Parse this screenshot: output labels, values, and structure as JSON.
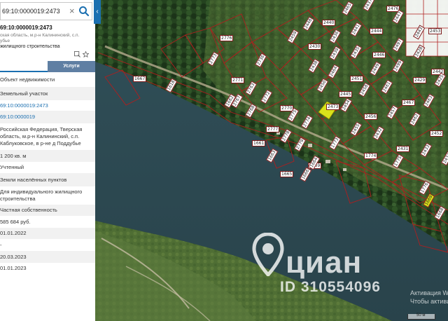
{
  "search": {
    "value": "69:10:0000019:2473"
  },
  "panel": {
    "cad_number": "69:10:0000019:2473",
    "address_short_1": "ская область, м.р-н Калининский, с.п.",
    "address_short_2": "убье",
    "usage_short": "жилищного строительства",
    "tabs": [
      {
        "label": ""
      },
      {
        "label": "Услуги"
      }
    ],
    "rows": [
      {
        "text": "Объект недвижимости"
      },
      {
        "text": "Земельный участок"
      },
      {
        "text": "69:10:0000019:2473",
        "link": true
      },
      {
        "text": "69:10:0000019",
        "link": true
      },
      {
        "text": "Российская Федерация, Тверская область, м.р-н Калининский, с.п. Каблуковское, в р-не д Поддубье"
      },
      {
        "text": "1 200 кв. м"
      },
      {
        "text": "Учтенный"
      },
      {
        "text": "Земли населённых пунктов"
      },
      {
        "text": "Для индивидуального жилищного строительства"
      },
      {
        "text": "Частная собственность"
      },
      {
        "text": "585 684 руб."
      },
      {
        "text": "01.01.2022"
      },
      {
        "text": "-"
      },
      {
        "text": "20.03.2023"
      },
      {
        "text": "01.01.2023"
      }
    ]
  },
  "map": {
    "parcel_labels": [
      "2476",
      "2437",
      "2465",
      "2440",
      "2448",
      "2459",
      "2430",
      "2436",
      "2441",
      "2444",
      "2447",
      "2443",
      "2453",
      "2439",
      "2435",
      "2446",
      "2497",
      "2428",
      "2442",
      "2438",
      "2464",
      "2451",
      "2449",
      "2499",
      "2429",
      "2425",
      "2450",
      "2445",
      "2458",
      "2461",
      "2467",
      "2463",
      "2454",
      "2456",
      "2457",
      "2462",
      "2452",
      "2455",
      "2432",
      "2431",
      "2433",
      "2434",
      "2776",
      "2736",
      "2773",
      "2771",
      "2763",
      "2772",
      "2770",
      "2775",
      "2774",
      "2777",
      "2778",
      "2779",
      "2769",
      "2768",
      "2767",
      "1667",
      "1618",
      "1662",
      "1661",
      "1663",
      "1664",
      "1665",
      "1666",
      "1773",
      "1774",
      "1775",
      "1776",
      "2473",
      "1668",
      "1669"
    ],
    "selected_parcel_color": "#d9e21b",
    "boundary_color": "#b01e1e",
    "water_color": "#2c4a52",
    "forest_color": "#203d1c"
  },
  "watermark": {
    "brand": "циан",
    "id": "ID 310554096"
  },
  "activation": {
    "line1": "Активация W",
    "line2": "Чтобы активиро"
  },
  "scale": {
    "label": "50 м"
  }
}
